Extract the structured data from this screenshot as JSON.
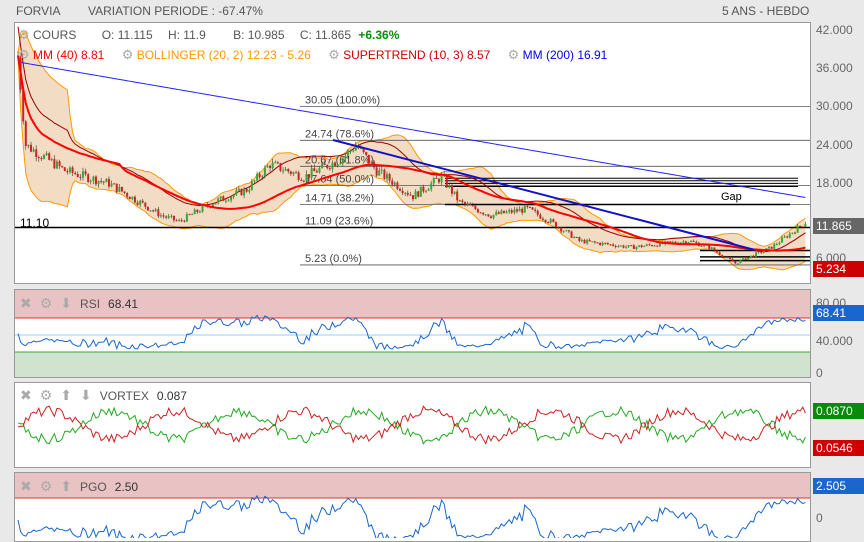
{
  "header": {
    "ticker": "FORVIA",
    "variation": "VARIATION PERIODE : -67.47%",
    "period": "5 ANS - HEBDO"
  },
  "legend": {
    "cours": {
      "label": "COURS",
      "o": "O: 11.115",
      "h": "H: 11.9",
      "b": "B: 10.985",
      "c": "C: 11.865",
      "chg": "+6.36%"
    },
    "mm40": "MM (40) 8.81",
    "bollinger": "BOLLINGER (20, 2) 12.23 - 5.26",
    "supertrend": "SUPERTREND (10, 3) 8.57",
    "mm200": "MM (200) 16.91"
  },
  "colors": {
    "mm40": "#ff0000",
    "bollinger": "#ff9900",
    "supertrend": "#cc0000",
    "mm200": "#0000ff",
    "up": "#33aa33",
    "down": "#cc2222",
    "rsi": "#1a66cc"
  },
  "price_axis": [
    "42.000",
    "36.000",
    "30.000",
    "24.000",
    "18.000",
    "6.000"
  ],
  "price_tags": {
    "last": "11.865",
    "low": "5.234"
  },
  "level_label": "11.10",
  "fib": [
    {
      "v": 30.05,
      "t": "30.05  (100.0%)"
    },
    {
      "v": 24.74,
      "t": "24.74  (78.6%)"
    },
    {
      "v": 20.67,
      "t": "20.67  (61.8%)"
    },
    {
      "v": 17.64,
      "t": "17.64  (50.0%)"
    },
    {
      "v": 14.71,
      "t": "14.71  (38.2%)"
    },
    {
      "v": 11.09,
      "t": "11.09  (23.6%)"
    },
    {
      "v": 5.23,
      "t": "5.23  (0.0%)"
    }
  ],
  "gap_label": "Gap",
  "price_path": [
    [
      0,
      38
    ],
    [
      3,
      24
    ],
    [
      18,
      20
    ],
    [
      35,
      18
    ],
    [
      55,
      13
    ],
    [
      62,
      12
    ],
    [
      75,
      15
    ],
    [
      88,
      17
    ],
    [
      97,
      21
    ],
    [
      110,
      19
    ],
    [
      125,
      22
    ],
    [
      130,
      24
    ],
    [
      138,
      20
    ],
    [
      152,
      16
    ],
    [
      163,
      19
    ],
    [
      170,
      15
    ],
    [
      182,
      13
    ],
    [
      196,
      14
    ],
    [
      205,
      12
    ],
    [
      216,
      9
    ],
    [
      236,
      8
    ],
    [
      258,
      9
    ],
    [
      266,
      8
    ],
    [
      276,
      5.5
    ],
    [
      290,
      8
    ],
    [
      303,
      11.9
    ]
  ],
  "rsi": {
    "label": "RSI",
    "value": "68.41",
    "axis": [
      "80.00",
      "40.000",
      "0"
    ],
    "tag": "68.41"
  },
  "vortex": {
    "label": "VORTEX",
    "value": "0.087",
    "tag_plus": "0.0870",
    "tag_minus": "0.0546"
  },
  "pgo": {
    "label": "PGO",
    "value": "2.50",
    "axis": [
      "0"
    ],
    "tag": "2.505"
  }
}
